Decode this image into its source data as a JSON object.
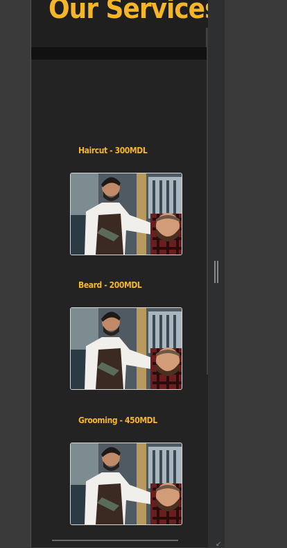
{
  "page": {
    "title": "Our Services"
  },
  "services": [
    {
      "label": "Haircut - 300MDL",
      "image": "barber-cutting-hair-photo"
    },
    {
      "label": "Beard - 200MDL",
      "image": "barber-cutting-hair-photo"
    },
    {
      "label": "Grooming - 450MDL",
      "image": "barber-cutting-hair-photo"
    }
  ],
  "colors": {
    "accent": "#f5b529",
    "background": "#232323",
    "header": "#1f1f1f"
  }
}
